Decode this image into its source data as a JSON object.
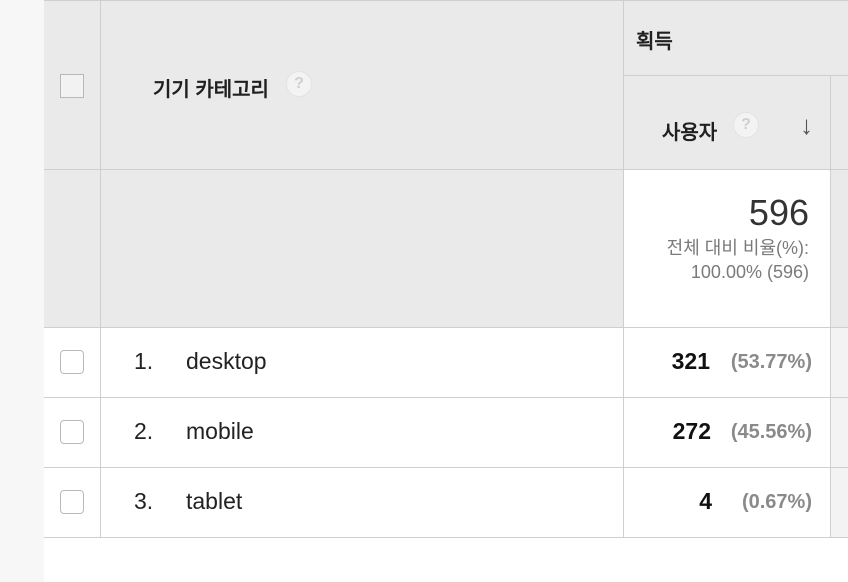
{
  "header": {
    "acquisition_label": "획득",
    "dimension_label": "기기 카테고리",
    "metric_label": "사용자",
    "help_glyph": "?",
    "sort_glyph": "↓"
  },
  "totals": {
    "value": "596",
    "caption_line1": "전체 대비 비율(%):",
    "caption_line2": "100.00% (596)"
  },
  "rows": [
    {
      "index": "1.",
      "name": "desktop",
      "users": "321",
      "pct": "(53.77%)"
    },
    {
      "index": "2.",
      "name": "mobile",
      "users": "272",
      "pct": "(45.56%)"
    },
    {
      "index": "3.",
      "name": "tablet",
      "users": "4",
      "pct": "(0.67%)"
    }
  ]
}
